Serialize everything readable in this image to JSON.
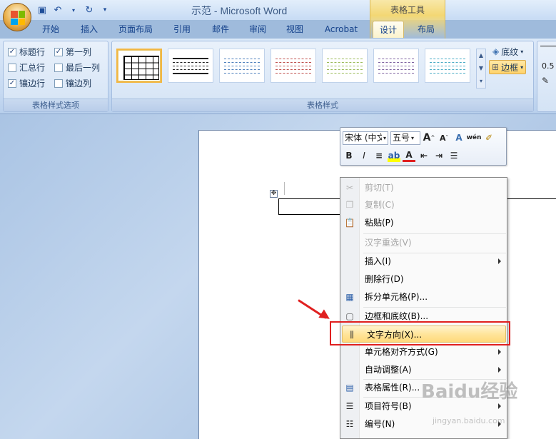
{
  "title_bar": {
    "doc_title": "示范 - Microsoft Word",
    "context_tab_group": "表格工具"
  },
  "ribbon_tabs": [
    {
      "label": "开始"
    },
    {
      "label": "插入"
    },
    {
      "label": "页面布局"
    },
    {
      "label": "引用"
    },
    {
      "label": "邮件"
    },
    {
      "label": "审阅"
    },
    {
      "label": "视图"
    },
    {
      "label": "Acrobat"
    },
    {
      "label": "设计",
      "active": true
    },
    {
      "label": "布局"
    }
  ],
  "style_options": {
    "group_label": "表格样式选项",
    "items": [
      {
        "label": "标题行",
        "checked": true
      },
      {
        "label": "第一列",
        "checked": true
      },
      {
        "label": "汇总行",
        "checked": false
      },
      {
        "label": "最后一列",
        "checked": false
      },
      {
        "label": "镶边行",
        "checked": true
      },
      {
        "label": "镶边列",
        "checked": false
      }
    ]
  },
  "table_styles": {
    "group_label": "表格样式",
    "swatch_colors": [
      "#000000",
      "#222222",
      "#4f81bd",
      "#c0504d",
      "#9bbb59",
      "#8064a2",
      "#4bacc6"
    ]
  },
  "borders_group": {
    "shading_label": "底纹",
    "borders_label": "边框",
    "width_value": "0.5"
  },
  "mini_toolbar": {
    "font_name": "宋体 (中文",
    "font_size": "五号",
    "grow_font": "A",
    "shrink_font": "A",
    "bold": "B",
    "italic": "I",
    "font_color_letter": "A"
  },
  "context_menu": [
    {
      "label": "剪切(T)",
      "icon": "scissors-icon",
      "disabled": true
    },
    {
      "label": "复制(C)",
      "icon": "copy-icon",
      "disabled": true
    },
    {
      "label": "粘贴(P)",
      "icon": "paste-icon"
    },
    {
      "separator": true
    },
    {
      "label": "汉字重选(V)",
      "disabled": true
    },
    {
      "separator": true
    },
    {
      "label": "插入(I)",
      "submenu": true
    },
    {
      "label": "删除行(D)"
    },
    {
      "label": "拆分单元格(P)...",
      "icon": "split-cells-icon"
    },
    {
      "separator": true
    },
    {
      "label": "边框和底纹(B)...",
      "icon": "borders-shading-icon"
    },
    {
      "separator": true
    },
    {
      "label": "文字方向(X)...",
      "icon": "text-direction-icon",
      "highlighted": true
    },
    {
      "label": "单元格对齐方式(G)",
      "submenu": true
    },
    {
      "label": "自动调整(A)",
      "submenu": true
    },
    {
      "separator": true
    },
    {
      "label": "表格属性(R)...",
      "icon": "table-properties-icon"
    },
    {
      "separator": true
    },
    {
      "label": "项目符号(B)",
      "icon": "bullets-icon",
      "submenu": true
    },
    {
      "label": "编号(N)",
      "icon": "numbering-icon",
      "submenu": true
    }
  ],
  "watermark": {
    "text": "Baidu经验",
    "sub": "jingyan.baidu.com"
  }
}
